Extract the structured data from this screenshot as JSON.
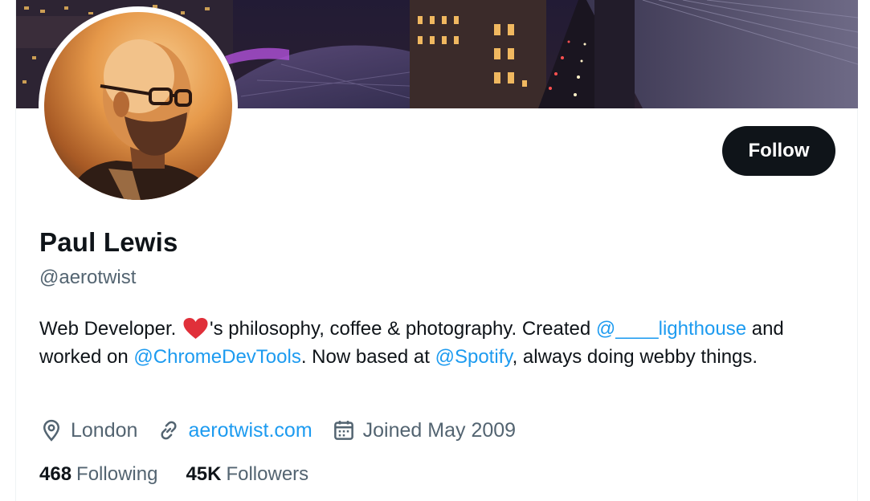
{
  "profile": {
    "name": "Paul Lewis",
    "handle": "@aerotwist",
    "follow_label": "Follow",
    "bio": {
      "part1": "Web Developer. ",
      "part2": "'s philosophy, coffee & photography. Created ",
      "mention_lighthouse": "@____lighthouse",
      "part3": " and worked on ",
      "mention_devtools": "@ChromeDevTools",
      "part4": ". Now based at ",
      "mention_spotify": "@Spotify",
      "part5": ", always doing webby things."
    },
    "location": "London",
    "website": "aerotwist.com",
    "joined": "Joined May 2009",
    "following_count": "468",
    "following_label": "Following",
    "followers_count": "45K",
    "followers_label": "Followers"
  },
  "icons": {
    "location": "location-pin-icon",
    "website": "link-icon",
    "joined": "calendar-icon",
    "heart": "red-heart-emoji"
  },
  "colors": {
    "accent": "#1d9bf0",
    "follow_bg": "#0f1419",
    "secondary_text": "#536471",
    "heart": "#e0303a"
  }
}
